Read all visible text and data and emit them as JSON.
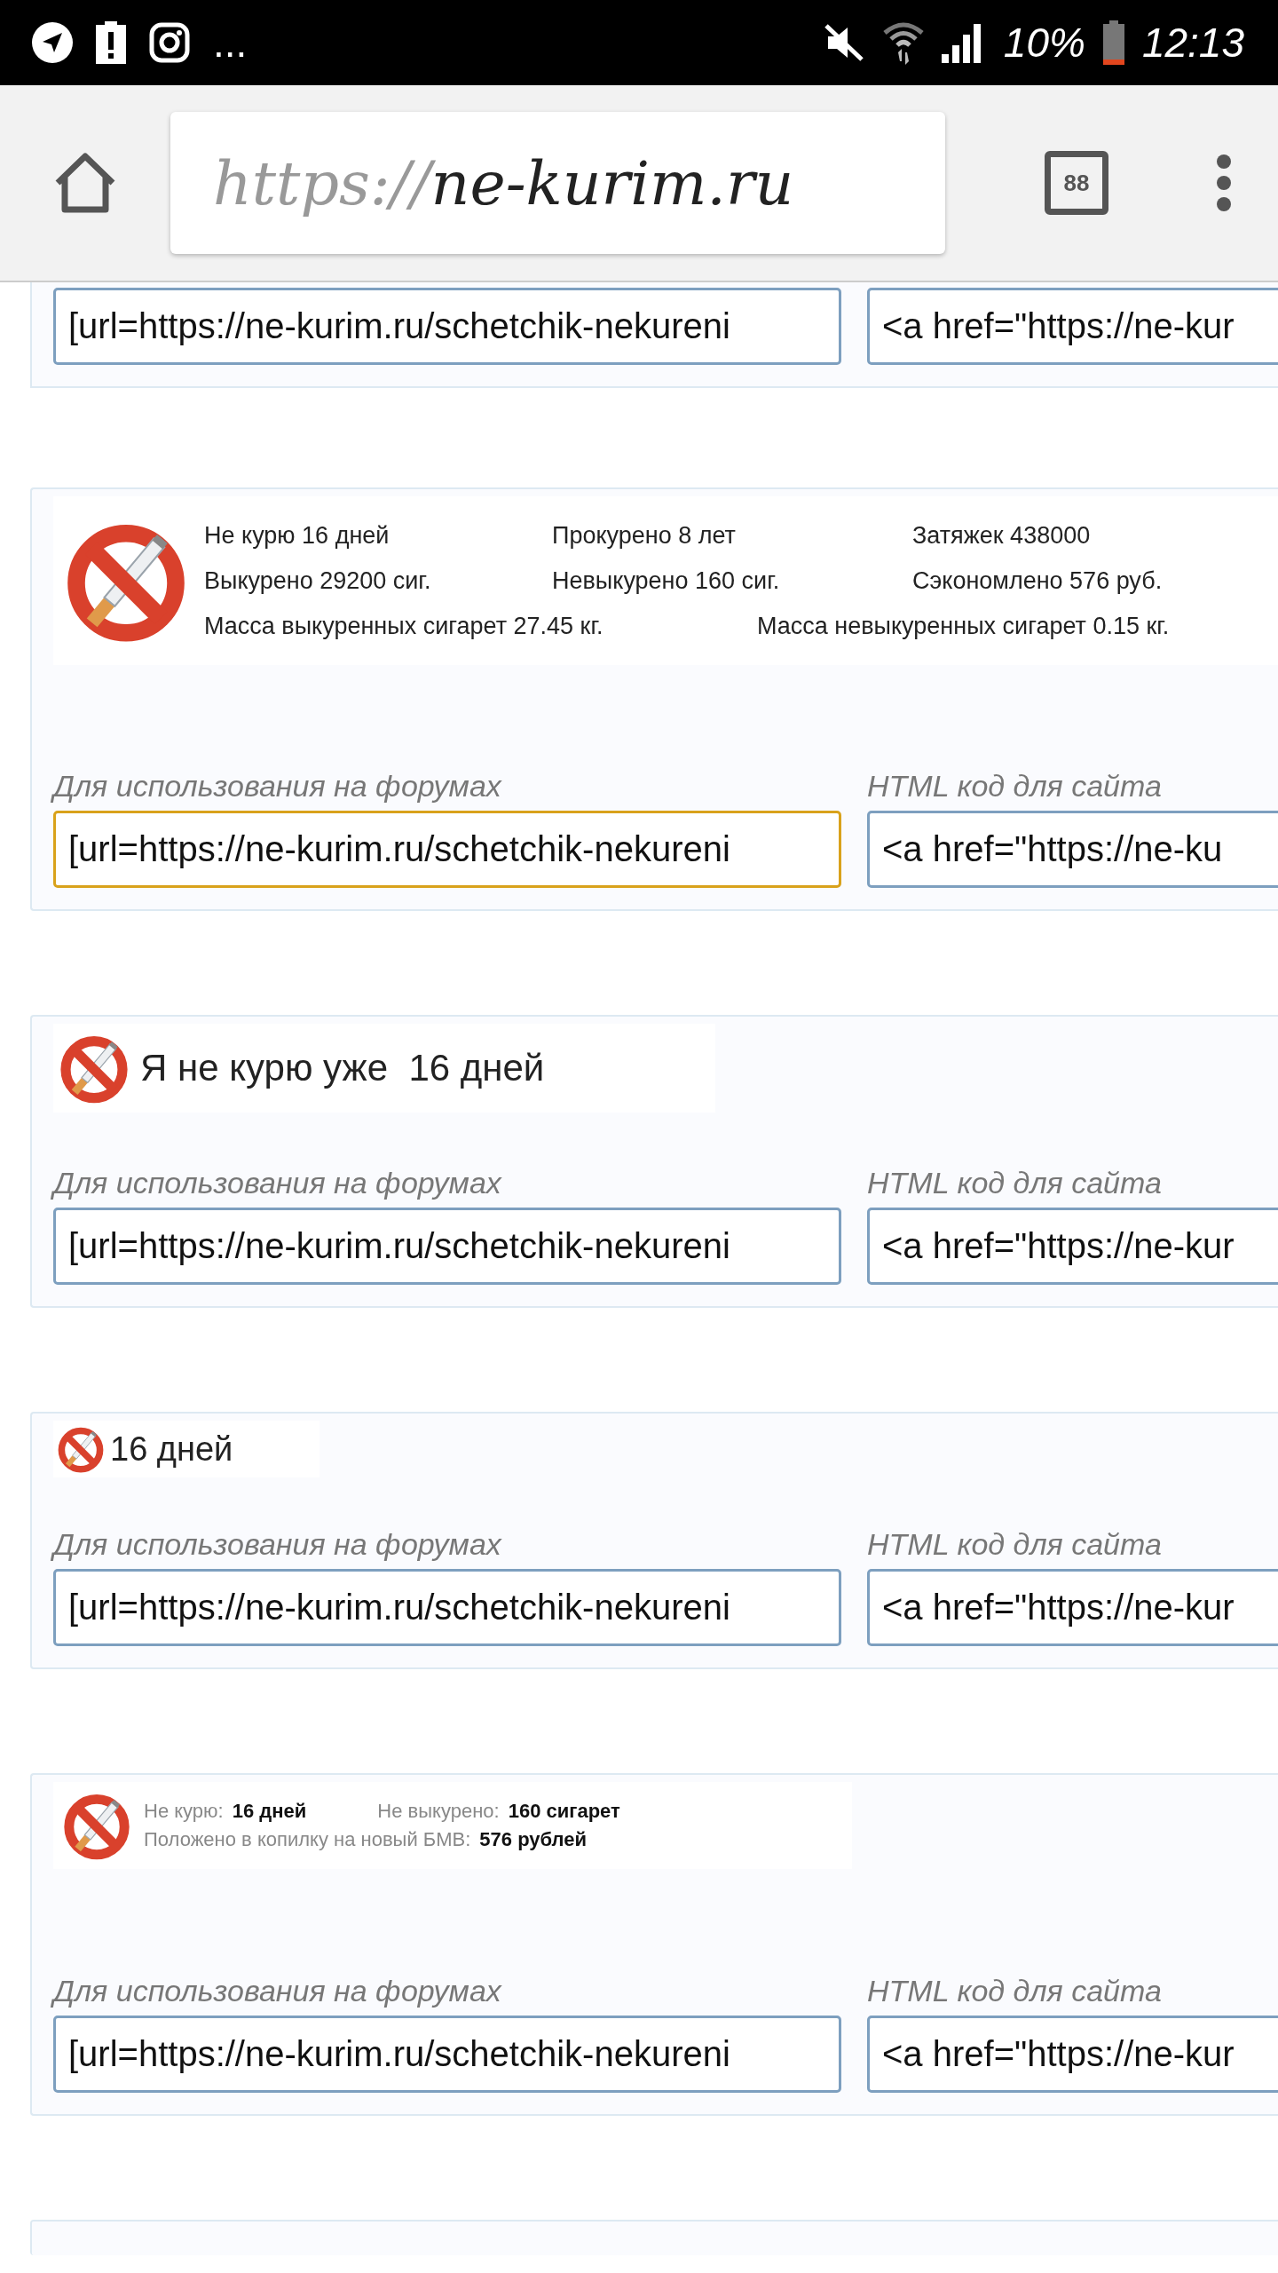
{
  "status_bar": {
    "more_notifications": "...",
    "battery": "10%",
    "time": "12:13"
  },
  "browser": {
    "url_scheme": "https://",
    "url_host": "ne-kurim.ru",
    "tab_count": "88"
  },
  "blocks": [
    {
      "kind": "fields-only",
      "fields": [
        {
          "value": "[url=https://ne-kurim.ru/schetchik-nekureni",
          "focused": false
        },
        {
          "value": "<a href=\"https://ne-kur",
          "focused": false
        }
      ]
    },
    {
      "kind": "stats",
      "rows": [
        [
          "Не курю 16 дней",
          "Прокурено 8 лет",
          "Затяжек 438000"
        ],
        [
          "Выкурено 29200 сиг.",
          "Невыкурено 160 сиг.",
          "Сэкономлено 576 руб."
        ]
      ],
      "mass_line": {
        "smoked": "Масса выкуренных сигарет 27.45 кг.",
        "unsmoked": "Масса невыкуренных сигарет 0.15 кг."
      },
      "fields": [
        {
          "label": "Для использования на форумах",
          "value": "[url=https://ne-kurim.ru/schetchik-nekureni",
          "focused": true
        },
        {
          "label": "HTML код для сайта",
          "value": "<a href=\"https://ne-ku",
          "focused": false
        }
      ]
    },
    {
      "kind": "title",
      "text": "Я не курю уже  16 дней",
      "fields": [
        {
          "label": "Для использования на форумах",
          "value": "[url=https://ne-kurim.ru/schetchik-nekureni",
          "focused": false
        },
        {
          "label": "HTML код для сайта",
          "value": "<a href=\"https://ne-kur",
          "focused": false
        }
      ]
    },
    {
      "kind": "compact",
      "text": "16 дней",
      "fields": [
        {
          "label": "Для использования на форумах",
          "value": "[url=https://ne-kurim.ru/schetchik-nekureni",
          "focused": false
        },
        {
          "label": "HTML код для сайта",
          "value": "<a href=\"https://ne-kur",
          "focused": false
        }
      ]
    },
    {
      "kind": "summary",
      "rows": [
        [
          {
            "label": "Не курю:",
            "value": "16 дней"
          },
          {
            "label": "Не выкурено:",
            "value": "160 сигарет"
          }
        ],
        [
          {
            "label": "Положено в копилку на новый БМВ:",
            "value": "576 рублей"
          }
        ]
      ],
      "fields": [
        {
          "label": "Для использования на форумах",
          "value": "[url=https://ne-kurim.ru/schetchik-nekureni",
          "focused": false
        },
        {
          "label": "HTML код для сайта",
          "value": "<a href=\"https://ne-kur",
          "focused": false
        }
      ]
    },
    {
      "kind": "cut"
    }
  ]
}
